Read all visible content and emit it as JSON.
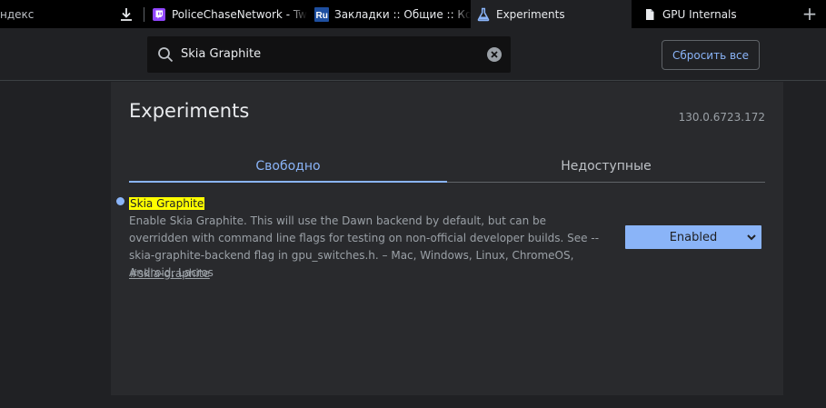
{
  "tabs": [
    {
      "label": "ндекс"
    },
    {
      "label": "PoliceChaseNetwork - Twitch"
    },
    {
      "label": "Закладки :: Общие :: Компьютер"
    },
    {
      "label": "Experiments"
    },
    {
      "label": "GPU Internals"
    }
  ],
  "new_tab_symbol": "+",
  "search": {
    "value": "Skia Graphite"
  },
  "header": {
    "reset_label": "Сбросить все"
  },
  "page": {
    "title": "Experiments",
    "version": "130.0.6723.172",
    "tab_available": "Свободно",
    "tab_unavailable": "Недоступные"
  },
  "experiment": {
    "name": "Skia Graphite",
    "description": "Enable Skia Graphite. This will use the Dawn backend by default, but can be overridden with command line flags for testing on non-official developer builds. See --skia-graphite-backend flag in gpu_switches.h. – Mac, Windows, Linux, ChromeOS, Android, Lacros",
    "link": "#skia-graphite",
    "state": "Enabled"
  },
  "icons": {
    "download": "download-icon",
    "twitch": "twitch-favicon",
    "ru": "ru-favicon",
    "experiments": "flask-icon",
    "gpu": "document-icon",
    "search": "search-icon",
    "clear": "clear-icon",
    "select": "chevron-down-icon"
  },
  "colors": {
    "accent": "#8ab4f8",
    "highlight": "#ffff00",
    "twitch": "#9146ff",
    "ru": "#1e4fa0"
  }
}
